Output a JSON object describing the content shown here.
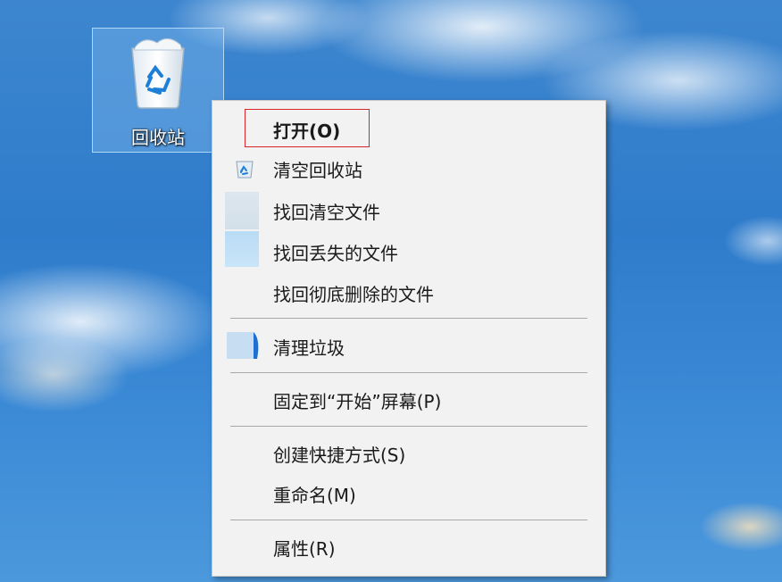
{
  "desktop": {
    "recycle_bin": {
      "label": "回收站",
      "icon": "recycle-bin-icon"
    }
  },
  "context_menu": {
    "items": [
      {
        "label": "打开(O)",
        "bold": true,
        "highlighted": true
      },
      {
        "label": "清空回收站",
        "icon": "recycle-bin-small-icon"
      },
      {
        "label": "找回清空文件"
      },
      {
        "label": "找回丢失的文件"
      },
      {
        "label": "找回彻底删除的文件"
      },
      {
        "label": "清理垃圾",
        "icon": "cleanup-icon"
      },
      {
        "label": "固定到“开始”屏幕(P)"
      },
      {
        "label": "创建快捷方式(S)"
      },
      {
        "label": "重命名(M)"
      },
      {
        "label": "属性(R)"
      }
    ]
  },
  "colors": {
    "highlight_border": "#d9262c",
    "menu_bg": "#f2f2f2",
    "sky": "#2f7ccb"
  }
}
